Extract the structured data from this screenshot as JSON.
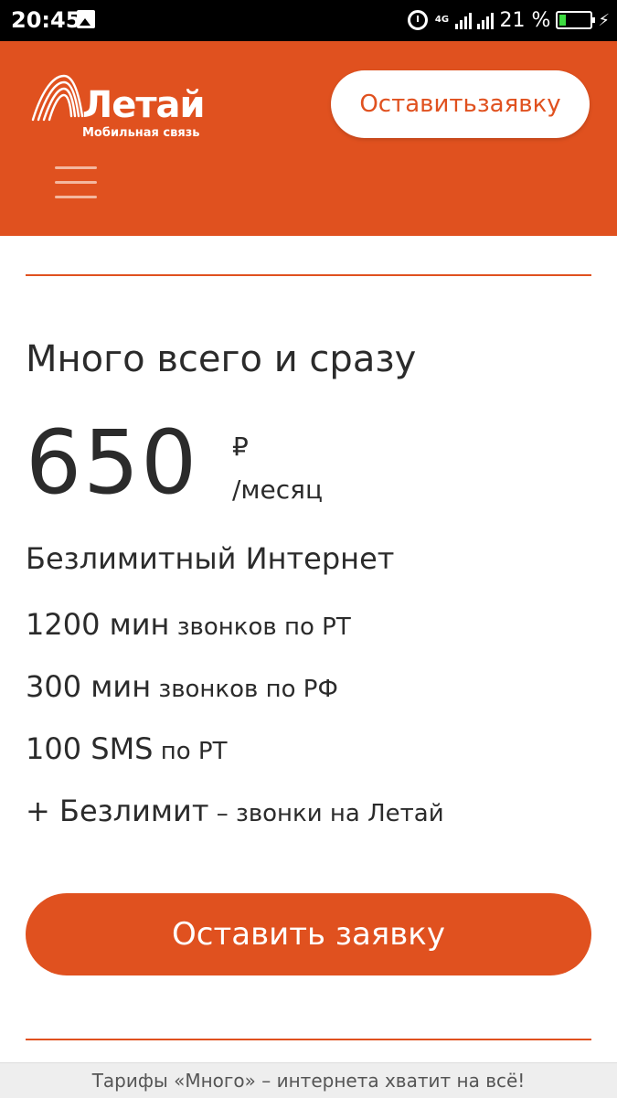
{
  "status_bar": {
    "time": "20:45",
    "network": "4G",
    "battery_percent": "21 %",
    "battery_level": 0.21,
    "icons": [
      "image-icon",
      "alarm-icon",
      "signal-icon",
      "battery-icon",
      "charging-icon"
    ]
  },
  "header": {
    "brand": "Летай",
    "brand_sub": "Мобильная связь",
    "cta_label": "Оставитьзаявку",
    "menu_icon": "hamburger-icon",
    "color": "#e0511f"
  },
  "tariff": {
    "title": "Много всего и сразу",
    "price": "650",
    "currency": "₽",
    "period": "/месяц",
    "features": [
      {
        "main": "Безлимитный Интернет",
        "detail": ""
      },
      {
        "main": "1200 мин",
        "detail": " звонков по РТ"
      },
      {
        "main": "300 мин",
        "detail": " звонков по РФ"
      },
      {
        "main": "100 SMS",
        "detail": " по РТ"
      },
      {
        "main": "+ Безлимит",
        "detail": " – звонки на Летай"
      }
    ],
    "cta_label": "Оставить заявку"
  },
  "footer": {
    "text": "Тарифы «Много» – интернета хватит на всё!"
  }
}
